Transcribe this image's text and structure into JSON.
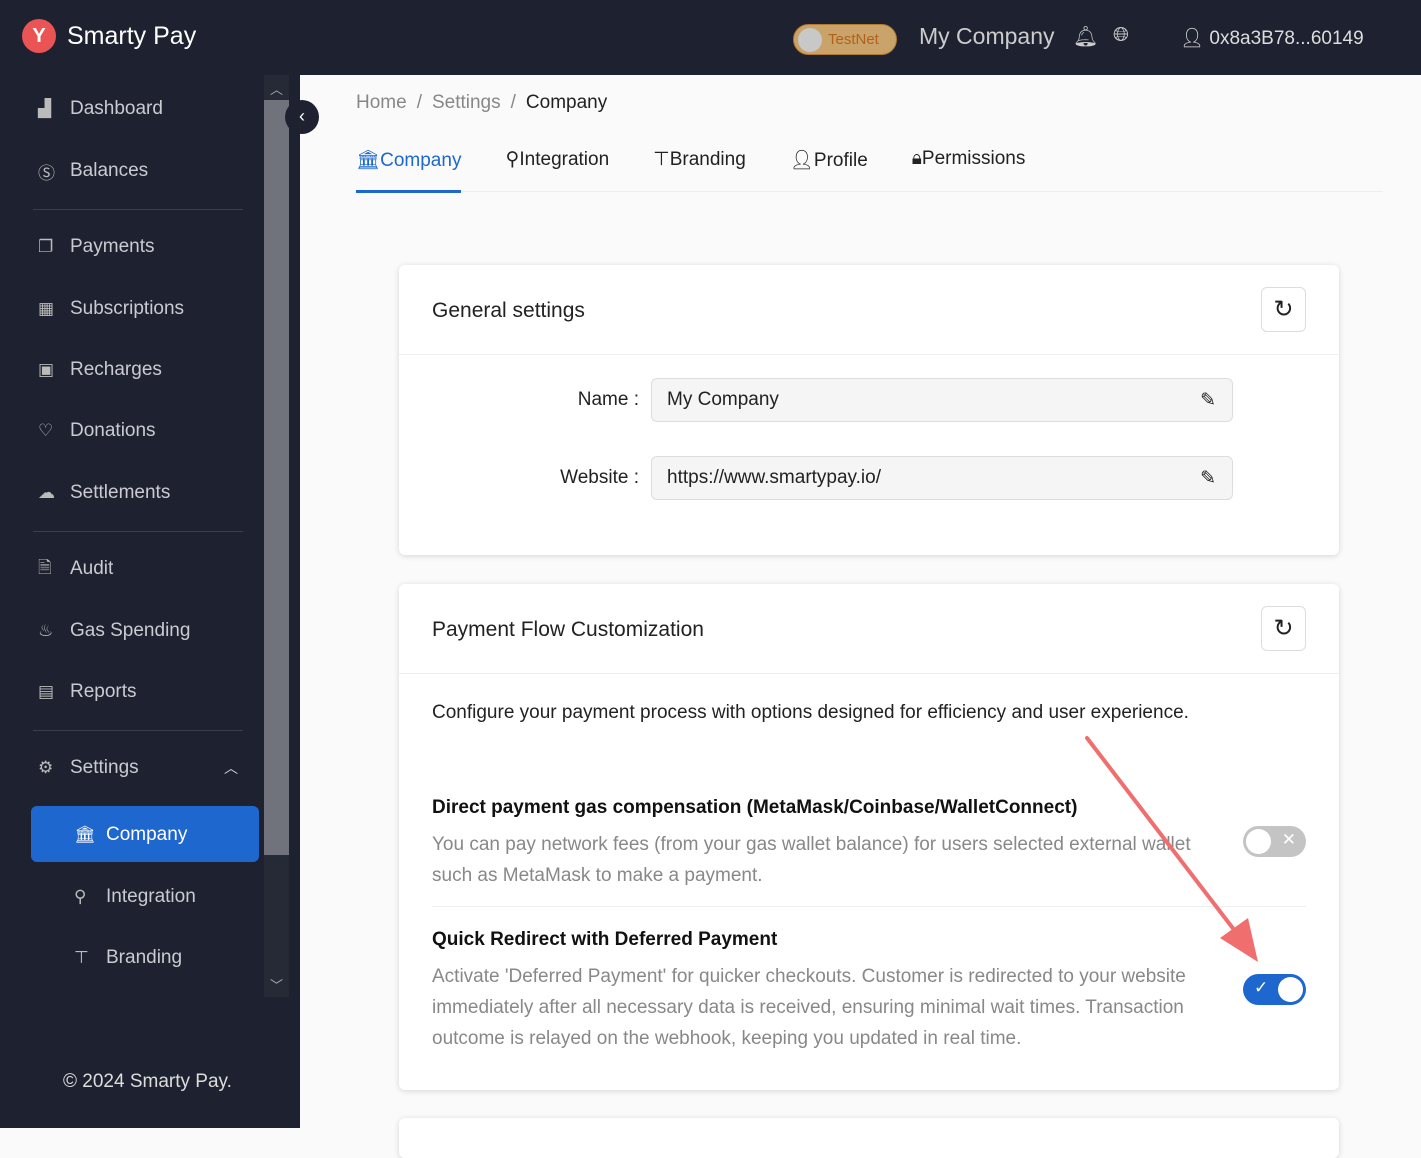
{
  "header": {
    "brand": "Smarty Pay",
    "network": "TestNet",
    "company": "My Company",
    "address": "0x8a3B78...60149"
  },
  "sidebar": {
    "items": [
      {
        "label": "Dashboard",
        "icon": "chart-icon"
      },
      {
        "label": "Balances",
        "icon": "dollar-icon"
      },
      {
        "label": "Payments",
        "icon": "copy-icon"
      },
      {
        "label": "Subscriptions",
        "icon": "calendar-icon"
      },
      {
        "label": "Recharges",
        "icon": "wallet-icon"
      },
      {
        "label": "Donations",
        "icon": "heart-icon"
      },
      {
        "label": "Settlements",
        "icon": "cloud-upload-icon"
      },
      {
        "label": "Audit",
        "icon": "file-search-icon"
      },
      {
        "label": "Gas Spending",
        "icon": "fire-icon"
      },
      {
        "label": "Reports",
        "icon": "book-icon"
      },
      {
        "label": "Settings",
        "icon": "gear-icon"
      }
    ],
    "sub_items": [
      {
        "label": "Company"
      },
      {
        "label": "Integration"
      },
      {
        "label": "Branding"
      }
    ],
    "footer": "© 2024 Smarty Pay."
  },
  "breadcrumb": [
    "Home",
    "Settings",
    "Company"
  ],
  "tabs": [
    "Company",
    "Integration",
    "Branding",
    "Profile",
    "Permissions"
  ],
  "general": {
    "title": "General settings",
    "name_label": "Name",
    "name_value": "My Company",
    "website_label": "Website",
    "website_value": "https://www.smartypay.io/"
  },
  "flow": {
    "title": "Payment Flow Customization",
    "description": "Configure your payment process with options designed for efficiency and user experience.",
    "options": [
      {
        "title": "Direct payment gas compensation (MetaMask/Coinbase/WalletConnect)",
        "description": "You can pay network fees (from your gas wallet balance) for users selected external wallet such as MetaMask to make a payment.",
        "enabled": false
      },
      {
        "title": "Quick Redirect with Deferred Payment",
        "description": "Activate 'Deferred Payment' for quicker checkouts. Customer is redirected to your website immediately after all necessary data is received, ensuring minimal wait times. Transaction outcome is relayed on the webhook, keeping you updated in real time.",
        "enabled": true
      }
    ]
  },
  "colors": {
    "accent": "#1d67cf",
    "sidebar": "#1e2230",
    "arrow": "#f06e6e"
  }
}
